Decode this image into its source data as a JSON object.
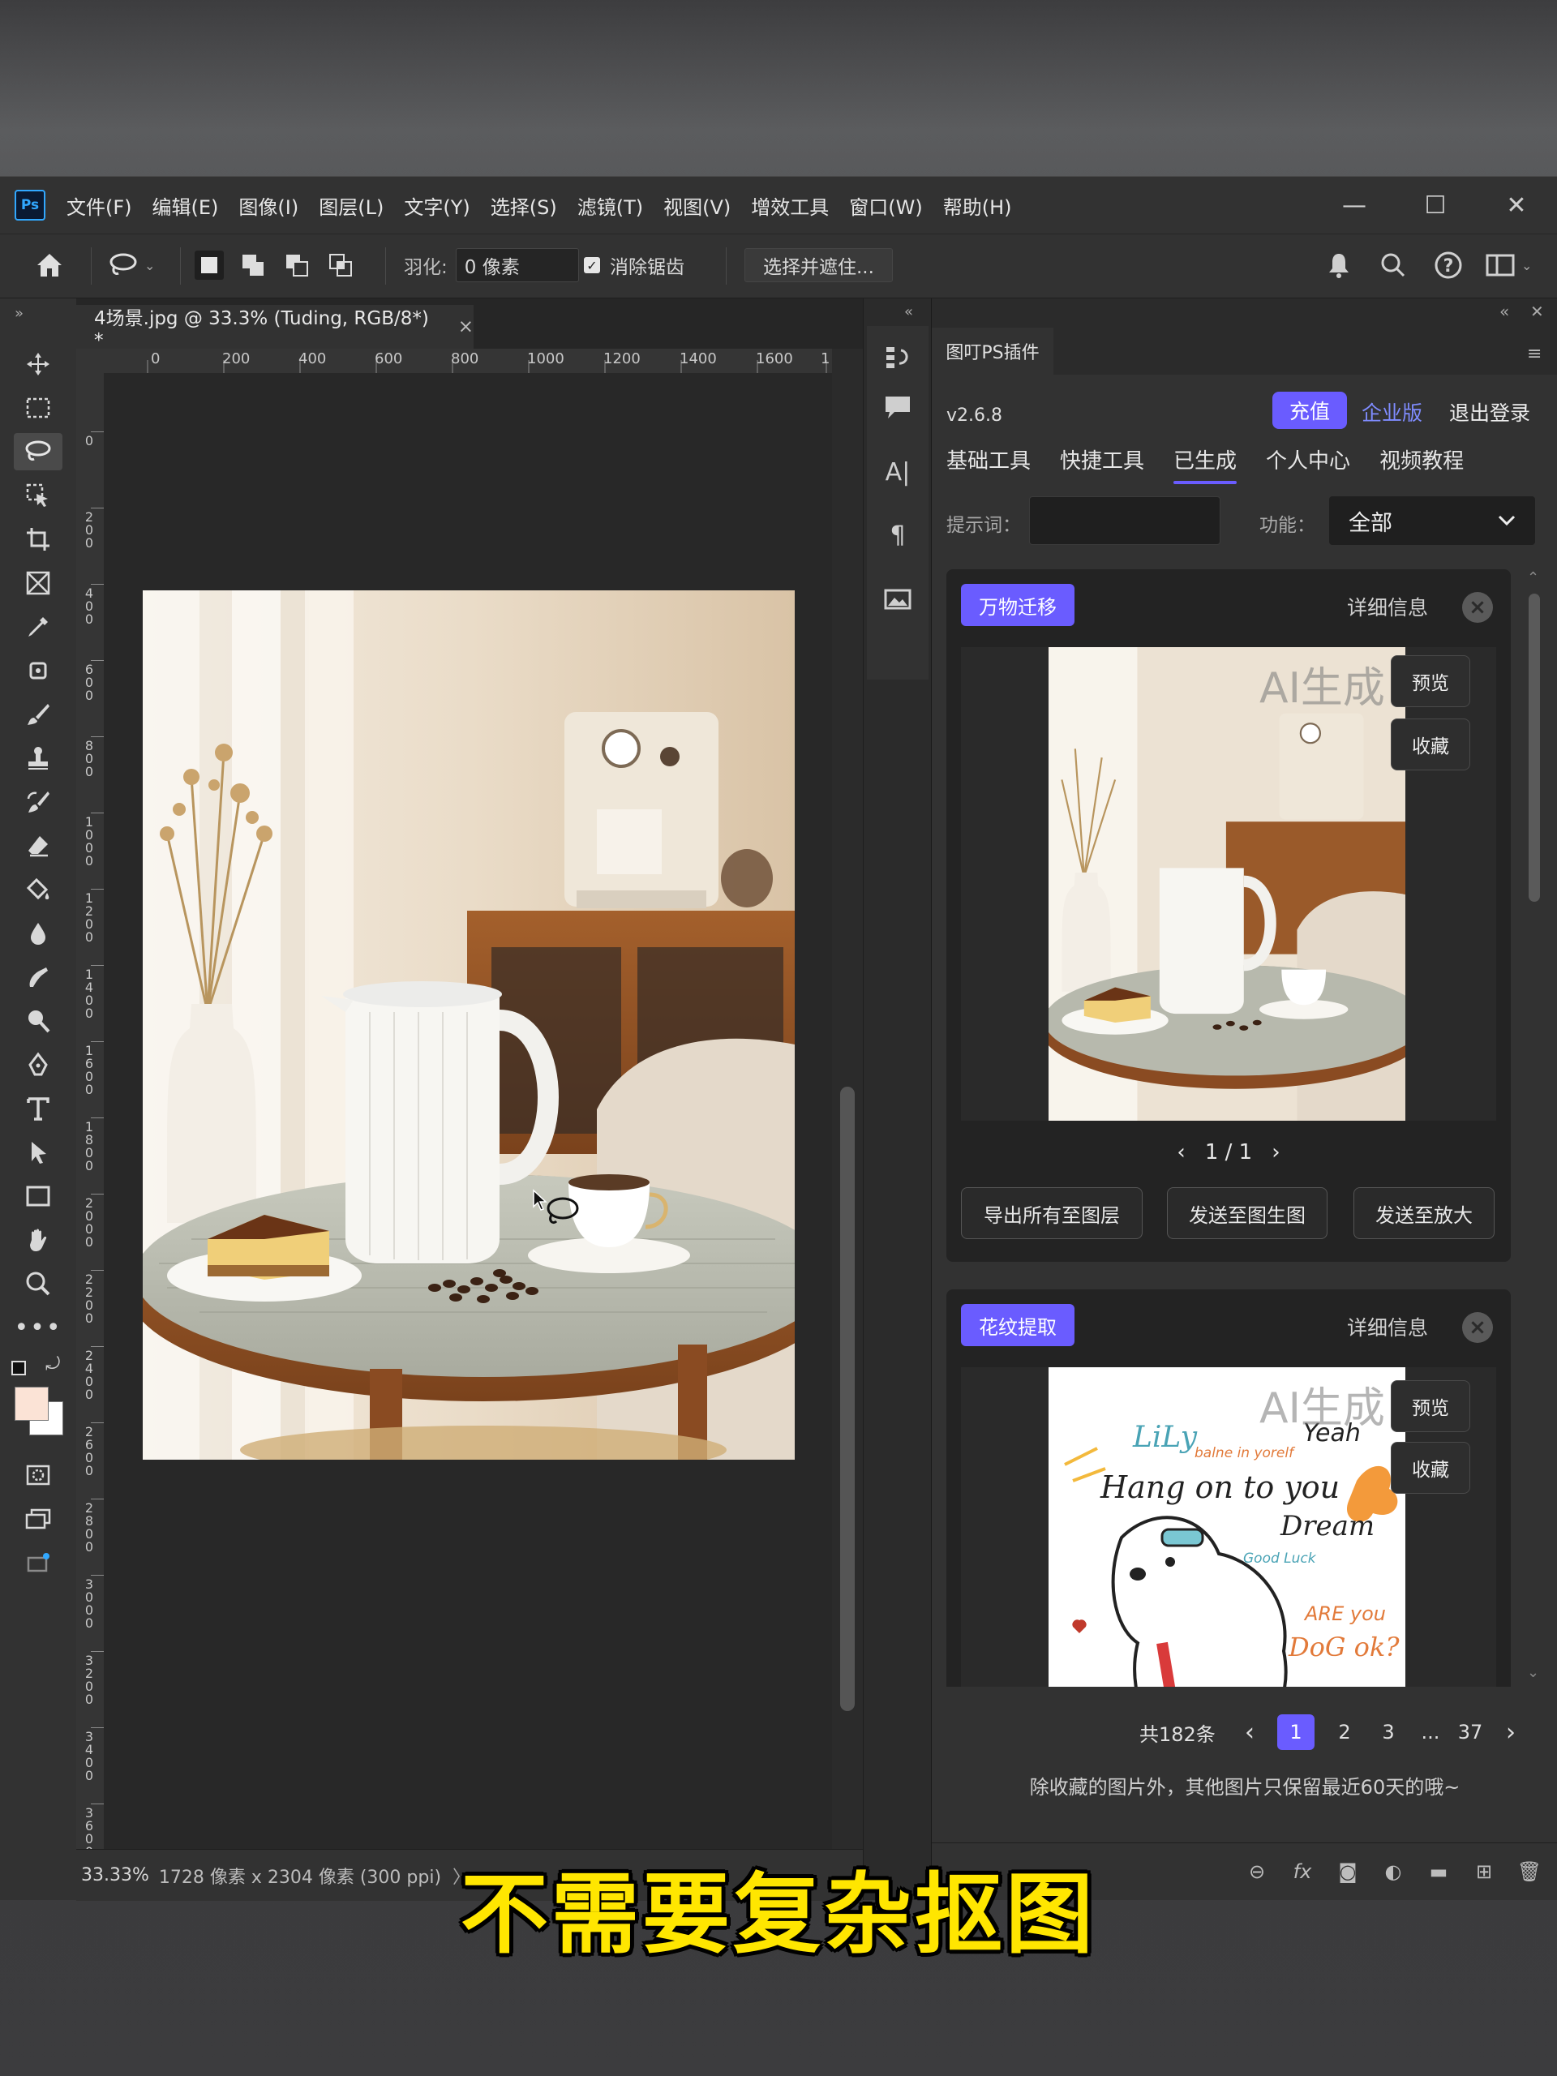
{
  "app": {
    "logo": "Ps",
    "menu": [
      "文件(F)",
      "编辑(E)",
      "图像(I)",
      "图层(L)",
      "文字(Y)",
      "选择(S)",
      "滤镜(T)",
      "视图(V)",
      "增效工具",
      "窗口(W)",
      "帮助(H)"
    ],
    "window_controls": [
      "—",
      "☐",
      "✕"
    ]
  },
  "options_bar": {
    "feather_label": "羽化:",
    "feather_value": "0 像素",
    "antialias_label": "消除锯齿",
    "antialias_checked": true,
    "select_mask_label": "选择并遮住..."
  },
  "document": {
    "tab_title": "4场景.jpg @ 33.3% (Tuding, RGB/8*) *",
    "tab_close": "×",
    "ruler_h_labels": [
      "0",
      "200",
      "400",
      "600",
      "800",
      "1000",
      "1200",
      "1400",
      "1600",
      "1"
    ],
    "ruler_v_labels": [
      "0",
      "2 0 0",
      "4 0 0",
      "6 0 0",
      "8 0 0",
      "1 0 0 0",
      "1 2 0 0",
      "1 4 0 0",
      "1 6 0 0",
      "1 8 0 0",
      "2 0 0 0",
      "2 2 0 0",
      "2 4 0 0",
      "2 6 0 0",
      "2 8 0 0",
      "3 0 0 0",
      "3 2 0 0",
      "3 4 0 0",
      "3 6 0 0",
      "3"
    ],
    "status_zoom": "33.33%",
    "status_info": "1728 像素 x 2304 像素 (300 ppi)",
    "status_arrow": "〉"
  },
  "plugin": {
    "tab_label": "图叮PS插件",
    "version": "v2.6.8",
    "recharge_label": "充值",
    "enterprise_label": "企业版",
    "logout_label": "退出登录",
    "tabs": [
      "基础工具",
      "快捷工具",
      "已生成",
      "个人中心",
      "视频教程"
    ],
    "active_tab": "已生成",
    "prompt_label": "提示词：",
    "prompt_value": "",
    "function_label": "功能：",
    "function_value": "全部",
    "cards": [
      {
        "tag": "万物迁移",
        "detail_label": "详细信息",
        "watermark": "AI生成",
        "preview_label": "预览",
        "favorite_label": "收藏",
        "pager": "1 / 1",
        "actions": [
          "导出所有至图层",
          "发送至图生图",
          "发送至放大"
        ]
      },
      {
        "tag": "花纹提取",
        "detail_label": "详细信息",
        "watermark": "AI生成",
        "preview_label": "预览",
        "favorite_label": "收藏",
        "art_words": [
          "LiLy",
          "balne in yorelf",
          "Yeah",
          "Hang on to you",
          "Dream",
          "Good Luck",
          "ARE you",
          "DoG ok?"
        ]
      }
    ],
    "total_label": "共182条",
    "pages": [
      "1",
      "2",
      "3",
      "...",
      "37"
    ],
    "current_page": "1",
    "retention_note": "除收藏的图片外，其他图片只保留最近60天的哦~"
  },
  "caption": "不需要复杂抠图",
  "colors": {
    "accent": "#6a5cff",
    "caption_yellow": "#ffe600",
    "ps_blue": "#31a8ff"
  }
}
